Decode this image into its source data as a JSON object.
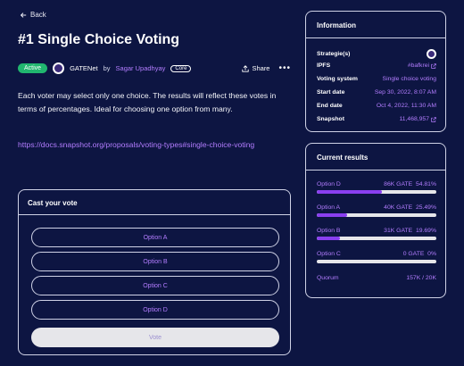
{
  "nav": {
    "back_label": "Back"
  },
  "proposal": {
    "title": "#1 Single Choice Voting",
    "status": "Active",
    "space_name": "GATENet",
    "by_text": "by",
    "author": "Sagar Upadhyay",
    "author_badge": "Core",
    "share_label": "Share",
    "more_label": "•••",
    "description": "Each voter may select only one choice. The results will reflect these votes in terms of percentages. Ideal for choosing one option from many.",
    "link": "https://docs.snapshot.org/proposals/voting-types#single-choice-voting"
  },
  "vote": {
    "heading": "Cast your vote",
    "options": [
      "Option A",
      "Option B",
      "Option C",
      "Option D"
    ],
    "vote_button": "Vote"
  },
  "information": {
    "heading": "Information",
    "rows": [
      {
        "key": "Strategie(s)",
        "value": ""
      },
      {
        "key": "IPFS",
        "value": "#bafkrei"
      },
      {
        "key": "Voting system",
        "value": "Single choice voting"
      },
      {
        "key": "Start date",
        "value": "Sep 30, 2022, 8:07 AM"
      },
      {
        "key": "End date",
        "value": "Oct 4, 2022, 11:30 AM"
      },
      {
        "key": "Snapshot",
        "value": "11,468,957"
      }
    ]
  },
  "results": {
    "heading": "Current results",
    "items": [
      {
        "label": "Option D",
        "amount": "86K GATE",
        "percent": "54.81%",
        "fraction": 0.5481
      },
      {
        "label": "Option A",
        "amount": "40K GATE",
        "percent": "25.49%",
        "fraction": 0.2549
      },
      {
        "label": "Option B",
        "amount": "31K GATE",
        "percent": "19.69%",
        "fraction": 0.1969
      },
      {
        "label": "Option C",
        "amount": "0 GATE",
        "percent": "0%",
        "fraction": 0
      }
    ],
    "quorum_label": "Quorum",
    "quorum_value": "157K / 20K"
  },
  "colors": {
    "background": "#0d1542",
    "accent": "#b37dff",
    "bar_fill": "#8a3ff0",
    "active": "#21b66f"
  }
}
